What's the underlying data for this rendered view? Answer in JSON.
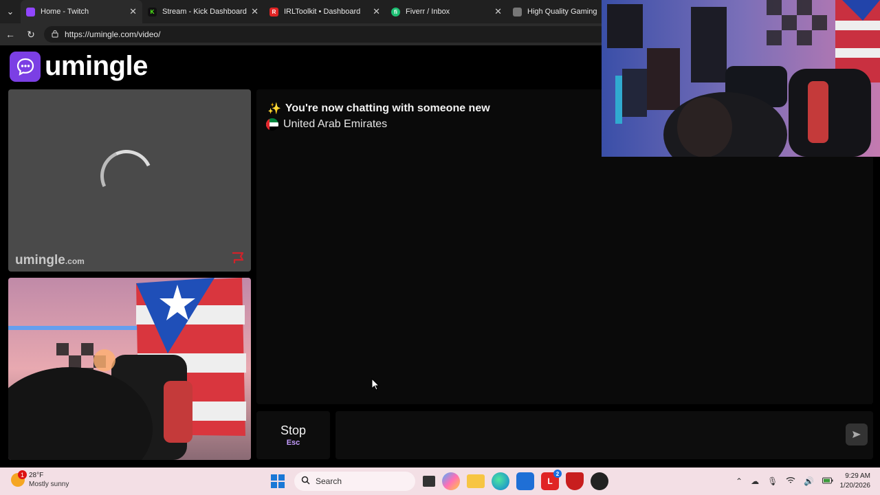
{
  "browser": {
    "tabs": [
      {
        "label": "Home - Twitch",
        "favicon_color": "#9146ff",
        "favicon": "T"
      },
      {
        "label": "Stream - Kick Dashboard",
        "favicon_color": "#53fc18",
        "favicon": "K"
      },
      {
        "label": "IRLToolkit • Dashboard",
        "favicon_color": "#e02424",
        "favicon": "R"
      },
      {
        "label": "Fiverr / Inbox",
        "favicon_color": "#1dbf73",
        "favicon": "fi"
      },
      {
        "label": "High Quality Gaming Ge",
        "favicon_color": "#888888",
        "favicon": ""
      }
    ],
    "url": "https://umingle.com/video/"
  },
  "site": {
    "logo_text": "umingle",
    "watermark_name": "umingle",
    "watermark_suffix": ".com"
  },
  "chat": {
    "status_icon": "sparkles",
    "status_text": "You're now chatting with someone new",
    "country": "United Arab Emirates",
    "country_flag": "uae-flag"
  },
  "controls": {
    "stop_label": "Stop",
    "stop_key": "Esc",
    "message_placeholder": ""
  },
  "taskbar": {
    "weather_badge": "1",
    "temperature": "28°F",
    "condition": "Mostly sunny",
    "search_label": "Search",
    "notification_badge": "2",
    "time": "9:29 AM",
    "date": "1/20/2026"
  },
  "colors": {
    "brand": "#7b3fe4",
    "taskbar_bg": "#f3dfe5"
  }
}
